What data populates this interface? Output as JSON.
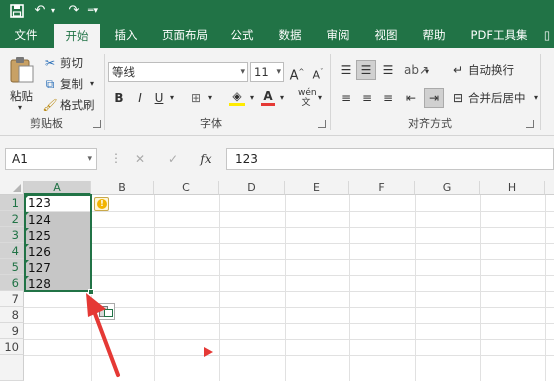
{
  "quick_access": {
    "save_icon": "save-icon",
    "undo_icon": "undo-icon",
    "redo_icon": "redo-icon",
    "customize_icon": "customize-icon"
  },
  "tabs": [
    {
      "label": "文件"
    },
    {
      "label": "开始"
    },
    {
      "label": "插入"
    },
    {
      "label": "页面布局"
    },
    {
      "label": "公式"
    },
    {
      "label": "数据"
    },
    {
      "label": "审阅"
    },
    {
      "label": "视图"
    },
    {
      "label": "帮助"
    },
    {
      "label": "PDF工具集"
    }
  ],
  "active_tab": "开始",
  "clipboard": {
    "paste_label": "粘贴",
    "cut_label": "剪切",
    "copy_label": "复制",
    "format_painter_label": "格式刷",
    "group_label": "剪贴板"
  },
  "font": {
    "font_name": "等线",
    "font_size": "11",
    "group_label": "字体"
  },
  "alignment": {
    "wrap_text_label": "自动换行",
    "merge_center_label": "合并后居中",
    "group_label": "对齐方式"
  },
  "formula_bar": {
    "name_box": "A1",
    "fx_label": "fx",
    "formula_value": "123"
  },
  "columns": [
    "A",
    "B",
    "C",
    "D",
    "E",
    "F",
    "G",
    "H"
  ],
  "rows": [
    "1",
    "2",
    "3",
    "4",
    "5",
    "6",
    "7",
    "8",
    "9",
    "10"
  ],
  "cells": {
    "A1": "123",
    "A2": "124",
    "A3": "125",
    "A4": "126",
    "A5": "127",
    "A6": "128"
  },
  "colors": {
    "accent": "#217346",
    "arrow": "#e53935",
    "selection_fill": "#c6c6c6"
  }
}
